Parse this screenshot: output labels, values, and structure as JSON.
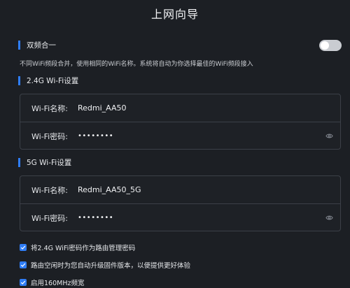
{
  "page": {
    "title": "上网向导"
  },
  "dual_band": {
    "label": "双频合一",
    "enabled": false,
    "description": "不同WiFi频段合并，使用相同的WiFi名称。系统将自动为你选择最佳的WiFi频段接入"
  },
  "wifi_24g": {
    "section_label": "2.4G Wi-Fi设置",
    "name_label": "Wi-Fi名称:",
    "name_value": "Redmi_AA50",
    "password_label": "Wi-Fi密码:",
    "password_mask": "••••••••"
  },
  "wifi_5g": {
    "section_label": "5G Wi-Fi设置",
    "name_label": "Wi-Fi名称:",
    "name_value": "Redmi_AA50_5G",
    "password_label": "Wi-Fi密码:",
    "password_mask": "••••••••"
  },
  "options": [
    {
      "label": "将2.4G WiFi密码作为路由管理密码",
      "checked": true
    },
    {
      "label": "路由空闲时为您自动升级固件版本，以便提供更好体验",
      "checked": true
    },
    {
      "label": "启用160MHz频宽",
      "checked": true
    }
  ],
  "colors": {
    "accent": "#2f7df6",
    "background": "#1c1f24",
    "border": "#3c4048"
  }
}
